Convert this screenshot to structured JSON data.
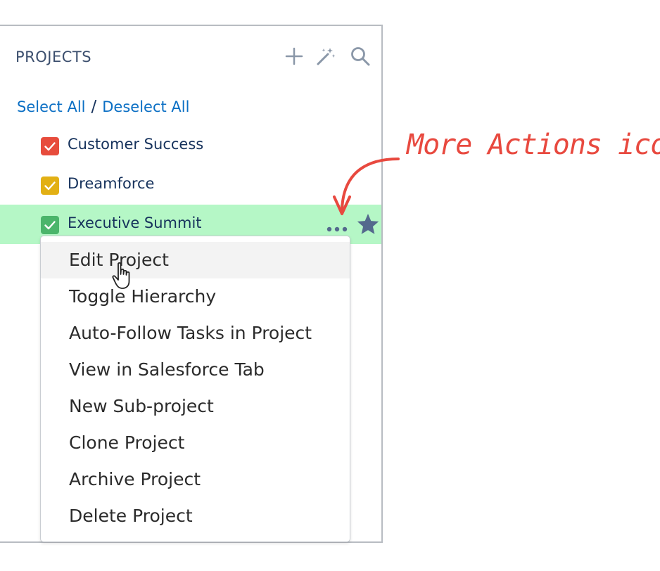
{
  "panel": {
    "title": "PROJECTS",
    "header_icons": [
      "plus-icon",
      "magic-wand-icon",
      "search-icon"
    ]
  },
  "selection": {
    "select_all": "Select All",
    "separator": "/",
    "deselect_all": "Deselect All"
  },
  "projects": [
    {
      "name": "Customer Success",
      "color": "#e74c3c",
      "checked": true,
      "highlighted": false
    },
    {
      "name": "Dreamforce",
      "color": "#e2b014",
      "checked": true,
      "highlighted": false
    },
    {
      "name": "Executive Summit",
      "color": "#4bb56b",
      "checked": true,
      "highlighted": true
    }
  ],
  "row_actions": {
    "more_icon": "more-actions-icon",
    "star_icon": "star-icon",
    "star_color": "#54698d"
  },
  "menu": {
    "items": [
      "Edit Project",
      "Toggle Hierarchy",
      "Auto-Follow Tasks in Project",
      "View in Salesforce Tab",
      "New Sub-project",
      "Clone Project",
      "Archive Project",
      "Delete Project"
    ],
    "hovered_index": 0
  },
  "annotation": {
    "text": "More Actions icon",
    "color": "#e8493f"
  },
  "colors": {
    "highlight_row": "#b5f7c6",
    "link": "#0b6fc4",
    "text_dark": "#16325c"
  }
}
